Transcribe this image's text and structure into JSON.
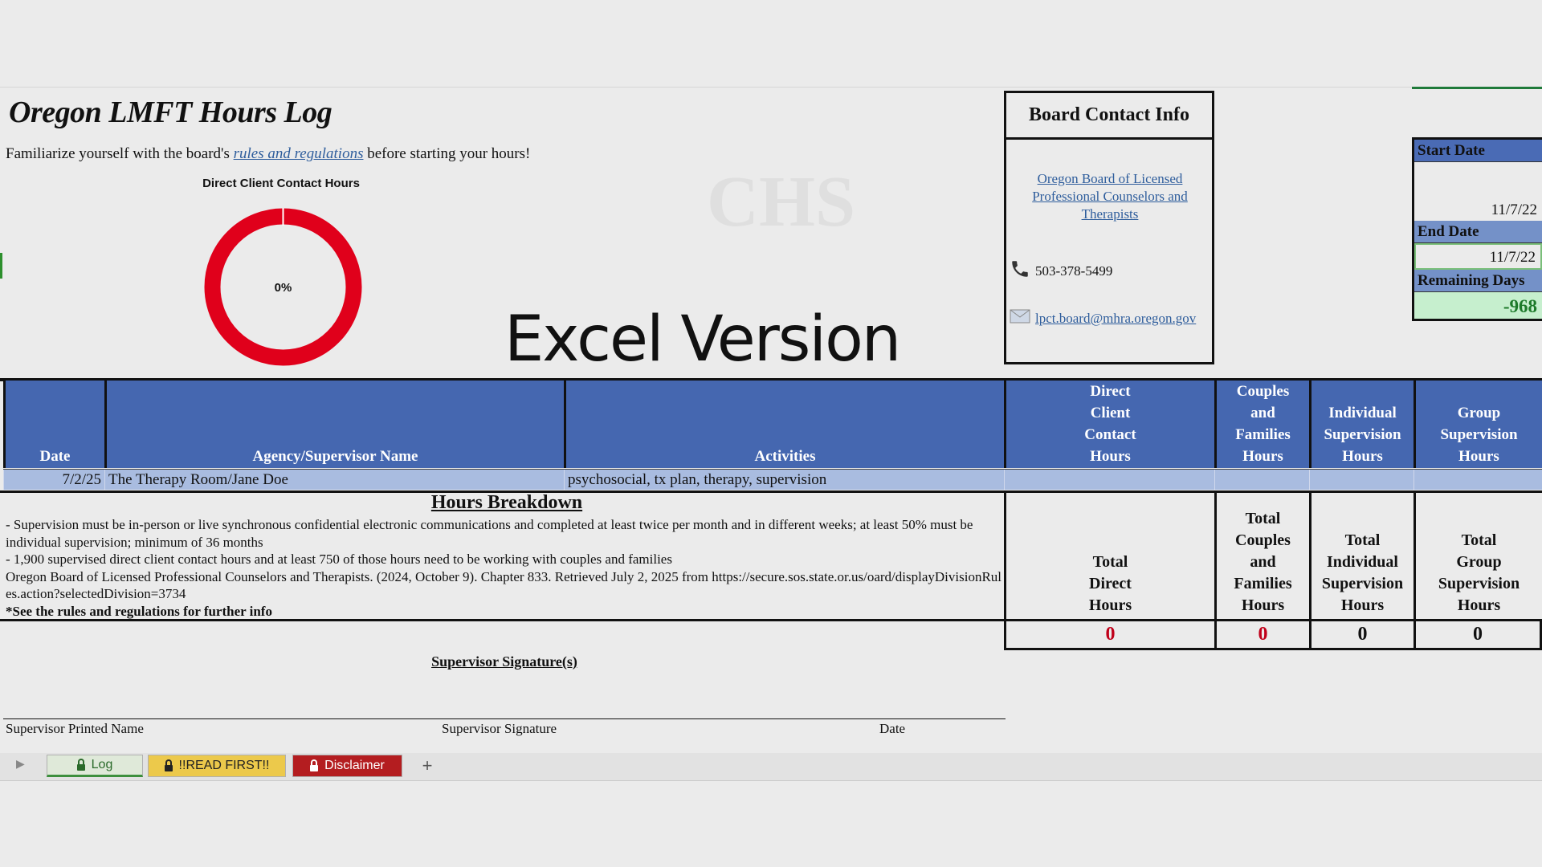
{
  "sheet": {
    "title": "Oregon LMFT Hours Log",
    "subtitle_pre": "Familiarize yourself with the board's ",
    "subtitle_link": "rules and regulations",
    "subtitle_post": " before starting your hours!",
    "donut": {
      "title": "Direct Client Contact Hours",
      "label": "0%",
      "progress": 0,
      "color": "#e0001b"
    },
    "overlay_text": "Excel Version"
  },
  "contact": {
    "heading": "Board Contact Info",
    "board_link": "Oregon Board of Licensed Professional Counselors and Therapists",
    "phone": "503-378-5499",
    "email": "lpct.board@mhra.oregon.gov"
  },
  "dates": {
    "start_label": "Start Date",
    "start_value": "11/7/22",
    "end_label": "End Date",
    "end_value": "11/7/22",
    "remaining_label": "Remaining Days",
    "remaining_value": "-968"
  },
  "table": {
    "headers": {
      "date": "Date",
      "agency": "Agency/Supervisor Name",
      "activities": "Activities",
      "direct": [
        "Direct",
        "Client",
        "Contact",
        "Hours"
      ],
      "couples": [
        "Couples",
        "and",
        "Families",
        "Hours"
      ],
      "individual": [
        "Individual",
        "Supervision",
        "Hours"
      ],
      "group": [
        "Group",
        "Supervision",
        "Hours"
      ]
    },
    "rows": [
      {
        "date": "7/2/25",
        "agency": "The Therapy Room/Jane Doe",
        "activities": "psychosocial, tx plan, therapy, supervision"
      }
    ]
  },
  "breakdown": {
    "title": "Hours Breakdown",
    "lines": [
      "- Supervision must be in-person or live synchronous confidential electronic communications and completed at least twice per month and in different weeks; at least 50% must be individual supervision; minimum of 36 months",
      "- 1,900 supervised direct client contact hours and at least 750 of those hours need to be working with couples and families",
      "Oregon Board of Licensed Professional Counselors and Therapists. (2024, October 9). Chapter 833. Retrieved July 2, 2025 from https://secure.sos.state.or.us/oard/displayDivisionRules.action?selectedDivision=3734"
    ],
    "note": "*See the rules and regulations for further info"
  },
  "totals": {
    "direct_label": [
      "Total",
      "Direct",
      "Hours"
    ],
    "couples_label": [
      "Total",
      "Couples",
      "and",
      "Families",
      "Hours"
    ],
    "individual_label": [
      "Total",
      "Individual",
      "Supervision",
      "Hours"
    ],
    "group_label": [
      "Total",
      "Group",
      "Supervision",
      "Hours"
    ],
    "direct_value": "0",
    "couples_value": "0",
    "individual_value": "0",
    "group_value": "0"
  },
  "signature": {
    "title": "Supervisor Signature(s)",
    "printed_name": "Supervisor Printed Name",
    "signature": "Supervisor Signature",
    "date": "Date"
  },
  "tabs": {
    "log": "Log",
    "readme": "!!READ FIRST!!",
    "disclaimer": "Disclaimer",
    "add": "+"
  },
  "icons": {
    "phone": "phone-icon",
    "mail": "mail-icon",
    "lock": "lock-icon"
  }
}
